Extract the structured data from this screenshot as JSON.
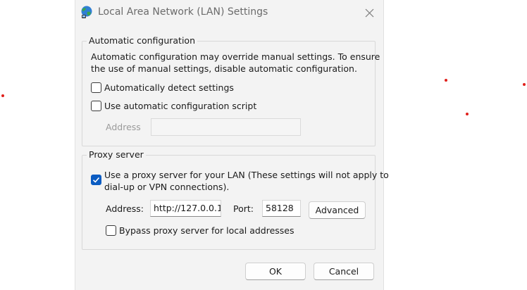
{
  "window": {
    "title": "Local Area Network (LAN) Settings",
    "icon": "globe-network-icon",
    "close_icon": "close-icon"
  },
  "automatic_configuration": {
    "group_label": "Automatic configuration",
    "description_line1": "Automatic configuration may override manual settings.  To ensure",
    "description_line2": "the use of manual settings, disable automatic configuration.",
    "detect_settings": {
      "label": "Automatically detect settings",
      "checked": false
    },
    "use_script": {
      "label": "Use automatic configuration script",
      "checked": false
    },
    "address": {
      "label": "Address",
      "value": "",
      "enabled": false
    }
  },
  "proxy_server": {
    "group_label": "Proxy server",
    "use_proxy": {
      "label_line1": "Use a proxy server for your LAN (These settings will not apply to",
      "label_line2": "dial-up or VPN connections).",
      "checked": true
    },
    "address_label": "Address:",
    "address_value": "http://127.0.0.1",
    "port_label": "Port:",
    "port_value": "58128",
    "advanced_label": "Advanced",
    "bypass_local": {
      "label": "Bypass proxy server for local addresses",
      "checked": false
    }
  },
  "buttons": {
    "ok": "OK",
    "cancel": "Cancel"
  },
  "colors": {
    "accent": "#0b5cc2",
    "dialog_bg": "#f3f3f3",
    "markers": "#e0201b"
  }
}
